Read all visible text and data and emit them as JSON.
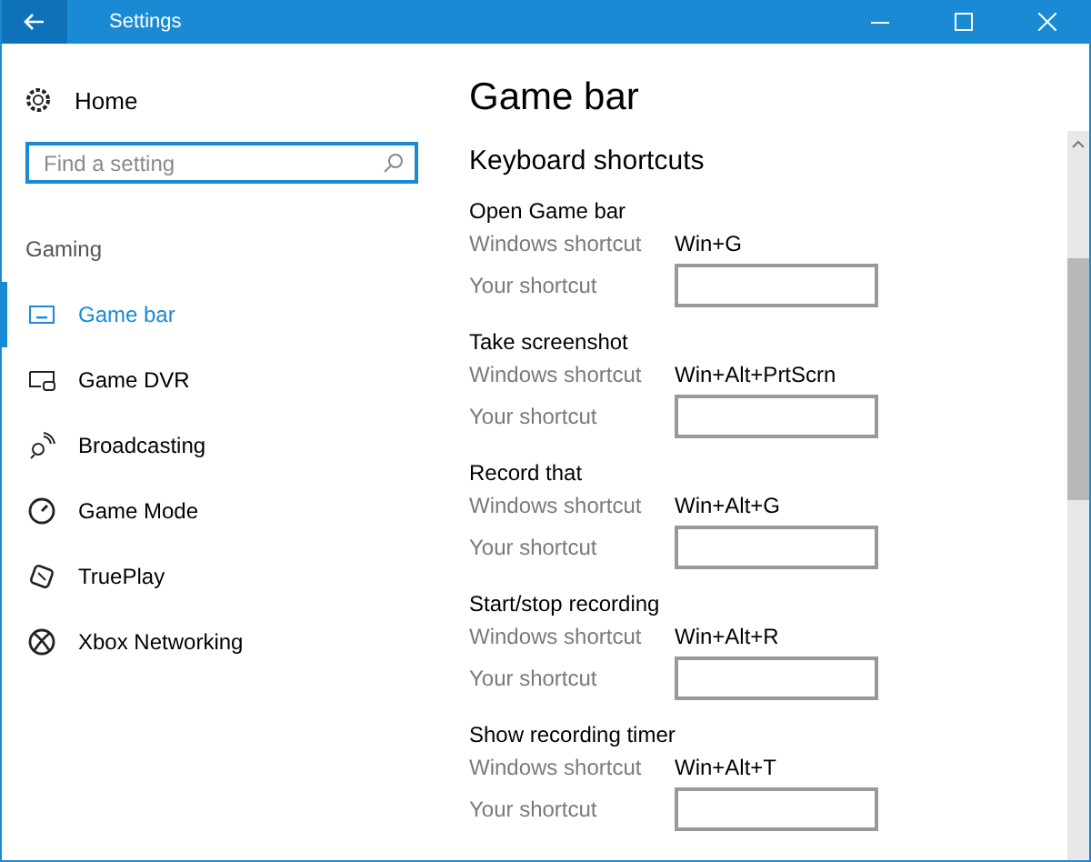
{
  "window": {
    "title": "Settings"
  },
  "sidebar": {
    "home": "Home",
    "search": {
      "placeholder": "Find a setting"
    },
    "section": "Gaming",
    "items": [
      {
        "label": "Game bar",
        "selected": true
      },
      {
        "label": "Game DVR",
        "selected": false
      },
      {
        "label": "Broadcasting",
        "selected": false
      },
      {
        "label": "Game Mode",
        "selected": false
      },
      {
        "label": "TruePlay",
        "selected": false
      },
      {
        "label": "Xbox Networking",
        "selected": false
      }
    ]
  },
  "content": {
    "title": "Game bar",
    "subtitle": "Keyboard shortcuts",
    "shortcuts": [
      {
        "name": "Open Game bar",
        "windows_label": "Windows shortcut",
        "windows_value": "Win+G",
        "your_label": "Your shortcut"
      },
      {
        "name": "Take screenshot",
        "windows_label": "Windows shortcut",
        "windows_value": "Win+Alt+PrtScrn",
        "your_label": "Your shortcut"
      },
      {
        "name": "Record that",
        "windows_label": "Windows shortcut",
        "windows_value": "Win+Alt+G",
        "your_label": "Your shortcut"
      },
      {
        "name": "Start/stop recording",
        "windows_label": "Windows shortcut",
        "windows_value": "Win+Alt+R",
        "your_label": "Your shortcut"
      },
      {
        "name": "Show recording timer",
        "windows_label": "Windows shortcut",
        "windows_value": "Win+Alt+T",
        "your_label": "Your shortcut"
      }
    ]
  }
}
